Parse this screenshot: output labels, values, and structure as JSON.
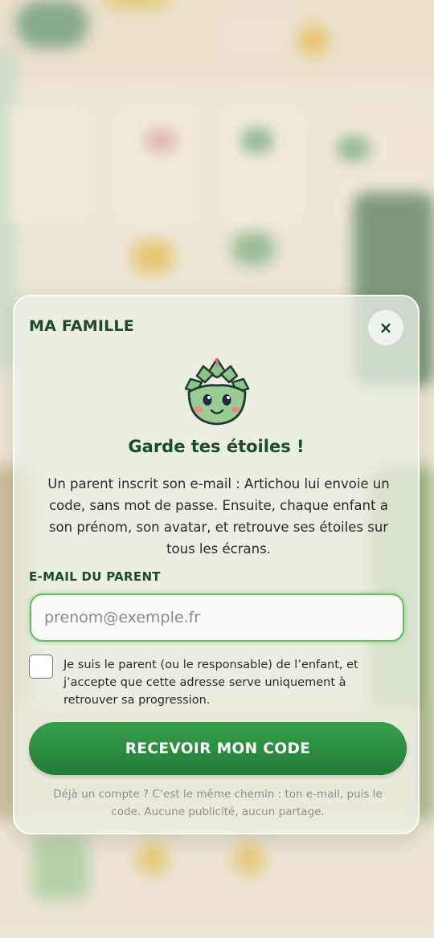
{
  "modal": {
    "title": "MA FAMILLE",
    "close_icon": "×",
    "mascot": "artichoke-mascot",
    "headline": "Garde tes étoiles !",
    "intro": "Un parent inscrit son e-mail : Artichou lui envoie un code, sans mot de passe. Ensuite, chaque enfant a son prénom, son avatar, et retrouve ses étoiles sur tous les écrans.",
    "email_label": "E-MAIL DU PARENT",
    "email_value": "",
    "email_placeholder": "prenom@exemple.fr",
    "consent_checked": false,
    "consent_text": "Je suis le parent (ou le responsable) de l’enfant, et j’accepte que cette adresse serve uniquement à retrouver sa progression.",
    "submit_label": "RECEVOIR MON CODE",
    "footnote": "Déjà un compte ? C’est le même chemin : ton e-mail, puis le code. Aucune publicité, aucun partage."
  },
  "colors": {
    "accent": "#2e8b44",
    "title": "#1d4a2c",
    "input_border": "#5fc15c"
  }
}
